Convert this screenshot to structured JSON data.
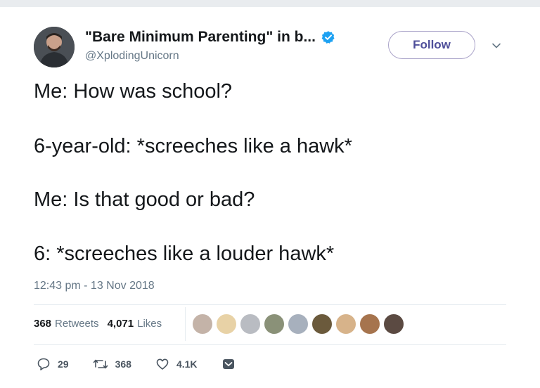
{
  "tweet": {
    "author_name": "\"Bare Minimum Parenting\" in b...",
    "author_handle": "@XplodingUnicorn",
    "follow_label": "Follow",
    "lines": [
      "Me: How was school?",
      "6-year-old: *screeches like a hawk*",
      "Me: Is that good or bad?",
      "6: *screeches like a louder hawk*"
    ],
    "timestamp": "12:43 pm - 13 Nov 2018",
    "stats": {
      "retweets_count": "368",
      "retweets_label": "Retweets",
      "likes_count": "4,071",
      "likes_label": "Likes"
    },
    "actions": {
      "replies": "29",
      "retweets": "368",
      "likes": "4.1K"
    }
  },
  "colors": {
    "verified_blue": "#1da1f2",
    "follow_border": "#a9a2c8",
    "muted_text": "#657786"
  },
  "icons": [
    "verified-badge-icon",
    "chevron-down-icon",
    "reply-icon",
    "retweet-icon",
    "heart-icon",
    "direct-message-icon"
  ]
}
